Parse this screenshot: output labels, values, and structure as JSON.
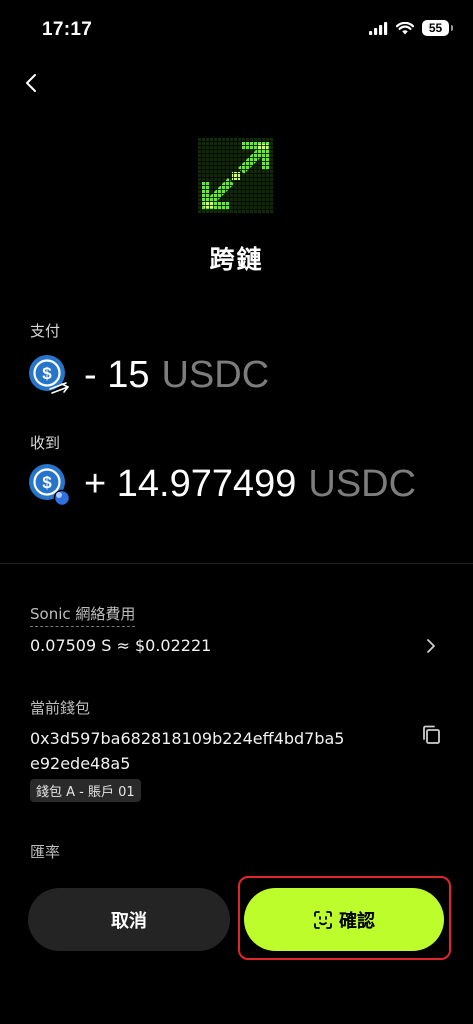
{
  "status_bar": {
    "time": "17:17",
    "battery": "55"
  },
  "header": {
    "title": "跨鏈"
  },
  "pay": {
    "label": "支付",
    "amount": "- 15",
    "unit": "USDC",
    "coin_icon": "usdc-icon"
  },
  "receive": {
    "label": "收到",
    "amount": "+ 14.977499",
    "unit": "USDC",
    "coin_icon": "usdc-icon"
  },
  "fee": {
    "label": "Sonic 網絡費用",
    "value": "0.07509 S ≈ $0.02221"
  },
  "wallet": {
    "label": "當前錢包",
    "address": "0x3d597ba682818109b224eff4bd7ba5e92ede48a5",
    "tag": "錢包 A - 賬戶 01"
  },
  "rate": {
    "label": "匯率"
  },
  "actions": {
    "cancel_label": "取消",
    "confirm_label": "確認"
  },
  "colors": {
    "accent": "#bdfd2c",
    "usdc_blue": "#2775ca",
    "highlight_border": "#e0262b"
  }
}
